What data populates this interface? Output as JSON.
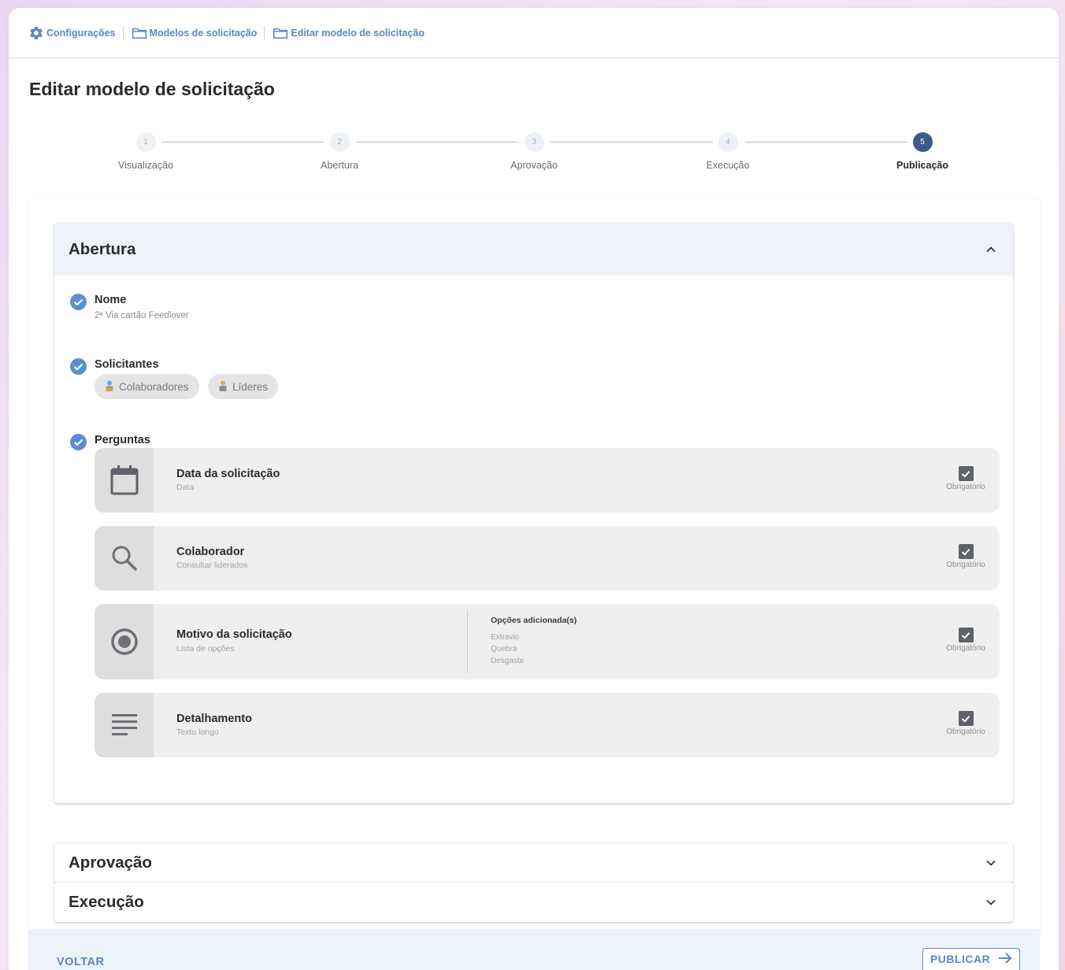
{
  "breadcrumb": {
    "items": [
      {
        "label": "Configurações",
        "icon": "gear-icon"
      },
      {
        "label": "Modelos de solicitação",
        "icon": "folder-icon"
      },
      {
        "label": "Editar modelo de solicitação",
        "icon": "folder-icon"
      }
    ]
  },
  "page": {
    "title": "Editar modelo de solicitação"
  },
  "stepper": {
    "active_step": 5,
    "steps": [
      {
        "number": "1",
        "label": "Visualização"
      },
      {
        "number": "2",
        "label": "Abertura"
      },
      {
        "number": "3",
        "label": "Aprovação"
      },
      {
        "number": "4",
        "label": "Execução"
      },
      {
        "number": "5",
        "label": "Publicação"
      }
    ]
  },
  "panels": {
    "abertura": {
      "title": "Abertura",
      "expanded": true,
      "nome": {
        "label": "Nome",
        "value": "2ª Via cartão Feedlover"
      },
      "solicitantes": {
        "label": "Solicitantes",
        "chips": [
          "Colaboradores",
          "Líderes"
        ]
      },
      "perguntas": {
        "label": "Perguntas",
        "required_label": "Obrigatório",
        "options_title": "Opções adicionada(s)",
        "items": [
          {
            "title": "Data da solicitação",
            "type": "Data",
            "icon": "calendar-icon",
            "required": true
          },
          {
            "title": "Colaborador",
            "type": "Consultar liderados",
            "icon": "search-icon",
            "required": true
          },
          {
            "title": "Motivo da solicitação",
            "type": "Lista de opções",
            "icon": "radio-button-icon",
            "required": true,
            "options": [
              "Extravio",
              "Quebra",
              "Desgaste"
            ]
          },
          {
            "title": "Detalhamento",
            "type": "Texto longo",
            "icon": "text-lines-icon",
            "required": true
          }
        ]
      }
    },
    "aprovacao": {
      "title": "Aprovação",
      "expanded": false
    },
    "execucao": {
      "title": "Execução",
      "expanded": false
    }
  },
  "footer": {
    "back_label": "VOLTAR",
    "publish_label": "PUBLICAR"
  },
  "colors": {
    "accent": "#5b86c4",
    "active_step": "#3d5a8a",
    "check": "#5a8fd1"
  }
}
